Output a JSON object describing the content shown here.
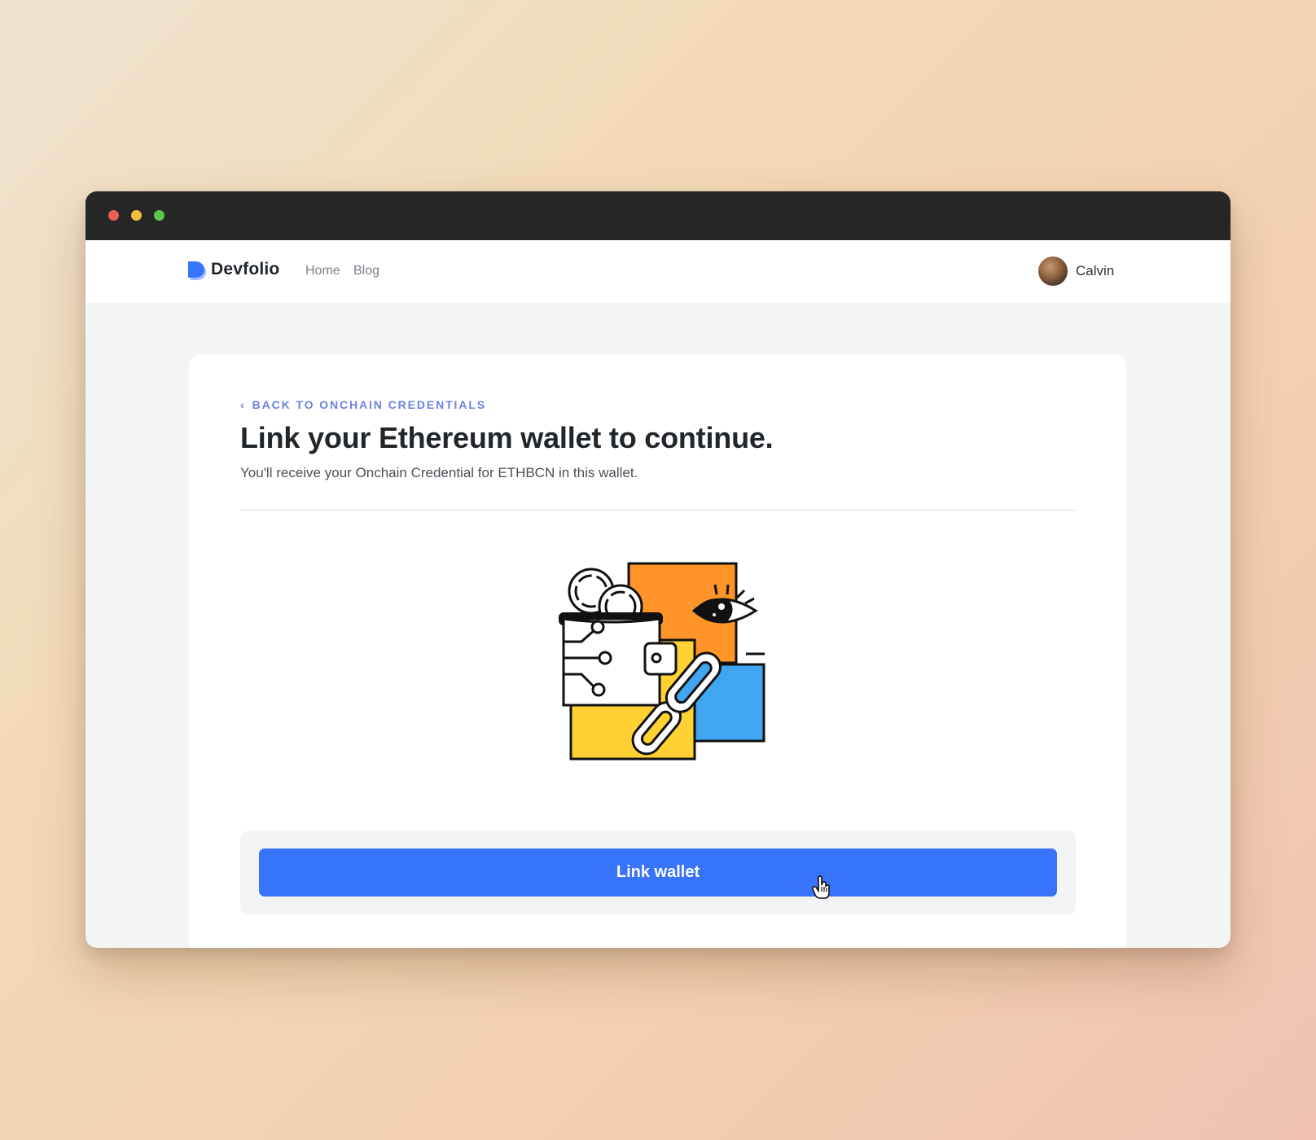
{
  "window": {
    "controls": [
      "close",
      "minimize",
      "maximize"
    ],
    "colors": {
      "close": "#ec5f57",
      "minimize": "#f3bd3f",
      "maximize": "#5ec64b"
    }
  },
  "navbar": {
    "brand": "Devfolio",
    "logo_icon": "devfolio-logo-icon",
    "links": [
      {
        "label": "Home"
      },
      {
        "label": "Blog"
      }
    ],
    "user": {
      "name": "Calvin",
      "avatar_icon": "user-avatar"
    }
  },
  "main": {
    "back_link": "BACK TO ONCHAIN CREDENTIALS",
    "title": "Link your Ethereum wallet to continue.",
    "subtitle": "You'll receive your Onchain Credential for ETHBCN in this wallet.",
    "illustration_icon": "wallet-chain-illustration",
    "cta_label": "Link wallet"
  },
  "colors": {
    "primary": "#3873fb",
    "link": "#6b82e0",
    "heading": "#21262b",
    "orange": "#ff9428",
    "yellow": "#ffd132",
    "blue": "#40a6f2"
  }
}
